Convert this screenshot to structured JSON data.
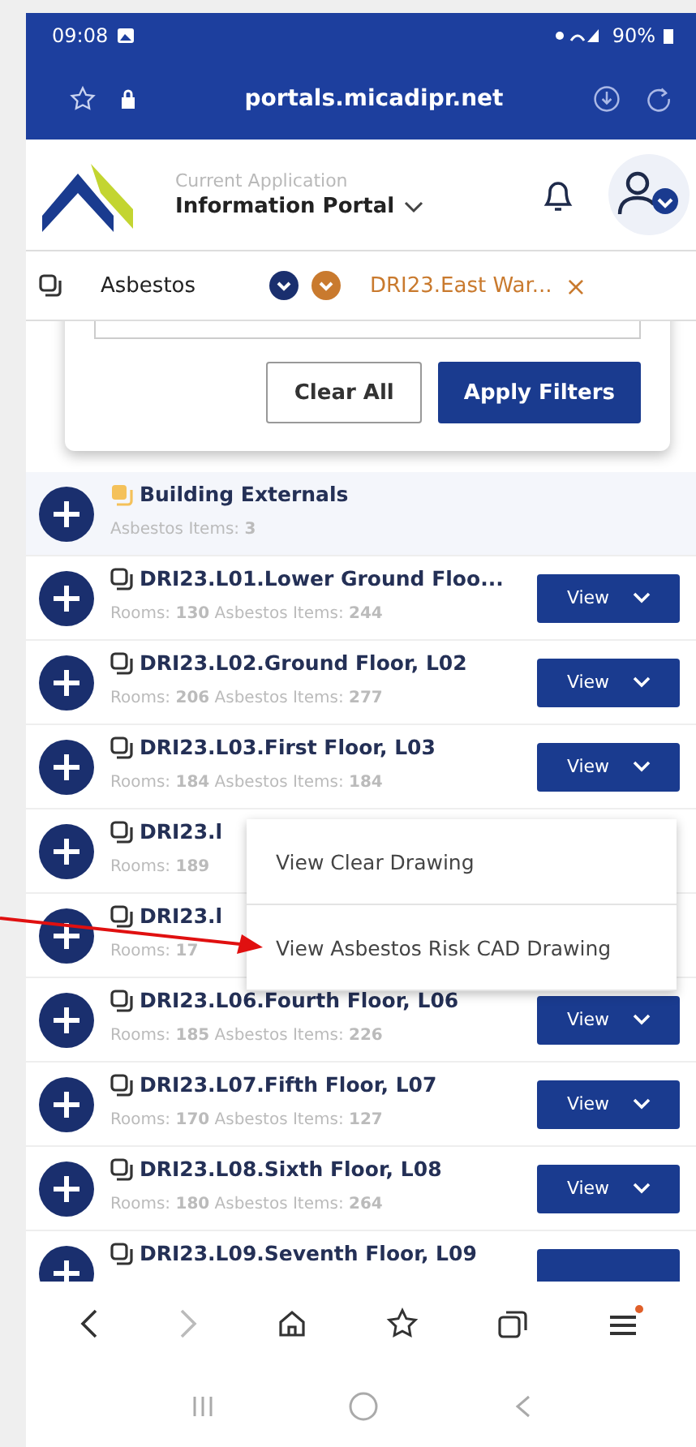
{
  "status_bar": {
    "time": "09:08",
    "battery": "90%"
  },
  "browser": {
    "url": "portals.micadipr.net"
  },
  "header": {
    "app_caption": "Current Application",
    "app_name": "Information Portal"
  },
  "filter_bar": {
    "module": "Asbestos",
    "selection": "DRI23.East War...",
    "close": "×"
  },
  "filter_panel": {
    "buttons": [
      {
        "label": "Clear All",
        "kind": "secondary"
      },
      {
        "label": "Apply Filters",
        "kind": "primary"
      }
    ]
  },
  "rows": [
    {
      "kind": "group",
      "title": "Building Externals",
      "meta": "Asbestos Items: **3**"
    },
    {
      "kind": "floor",
      "title": "DRI23.L01.Lower Ground Floo...",
      "meta": "Rooms: **130** Asbestos Items: **244**",
      "button": "View"
    },
    {
      "kind": "floor",
      "title": "DRI23.L02.Ground Floor, L02",
      "meta": "Rooms: **206** Asbestos Items: **277**",
      "button": "View"
    },
    {
      "kind": "floor",
      "title": "DRI23.L03.First Floor, L03",
      "meta": "Rooms: **184** Asbestos Items: **184**",
      "button": "View"
    },
    {
      "kind": "floor",
      "title": "DRI23.l",
      "meta": "Rooms: **189**"
    },
    {
      "kind": "floor",
      "title": "DRI23.l",
      "meta": "Rooms: **17**"
    },
    {
      "kind": "floor",
      "title": "DRI23.L06.Fourth Floor, L06",
      "meta": "Rooms: **185** Asbestos Items: **226**",
      "button": "View"
    },
    {
      "kind": "floor",
      "title": "DRI23.L07.Fifth Floor, L07",
      "meta": "Rooms: **170** Asbestos Items: **127**",
      "button": "View"
    },
    {
      "kind": "floor",
      "title": "DRI23.L08.Sixth Floor, L08",
      "meta": "Rooms: **180** Asbestos Items: **264**",
      "button": "View"
    },
    {
      "kind": "floor",
      "title": "DRI23.L09.Seventh Floor, L09",
      "button": ""
    }
  ],
  "dropdown_menu": {
    "items": [
      "View Clear Drawing",
      "View Asbestos Risk CAD Drawing"
    ]
  },
  "browser_toolbar": {
    "menu_notification": true
  }
}
